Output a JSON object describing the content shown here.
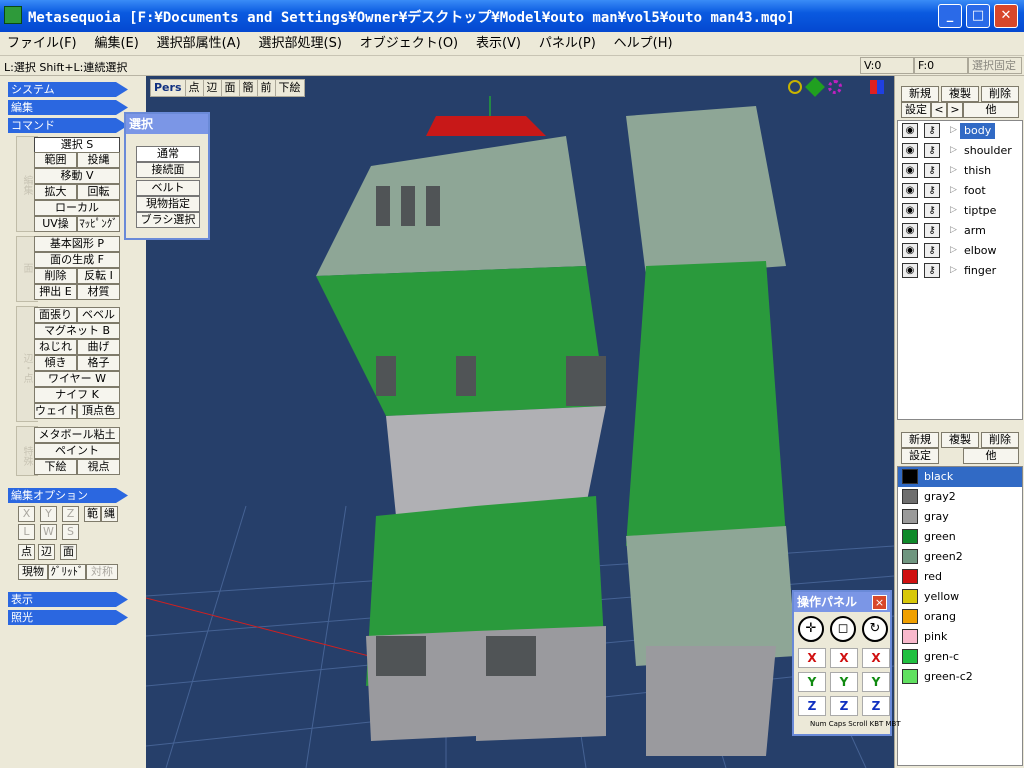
{
  "titlebar": {
    "title": "Metasequoia [F:¥Documents and Settings¥Owner¥デスクトップ¥Model¥outo man¥vol5¥outo man43.mqo]",
    "min": "_",
    "max": "□",
    "close": "✕"
  },
  "menu": [
    "ファイル(F)",
    "編集(E)",
    "選択部属性(A)",
    "選択部処理(S)",
    "オブジェクト(O)",
    "表示(V)",
    "パネル(P)",
    "ヘルプ(H)"
  ],
  "hint": "L:選択  Shift+L:連続選択",
  "status": {
    "v": "V:0",
    "f": "F:0",
    "lock": "選択固定"
  },
  "left": {
    "sections": {
      "system": "システム",
      "edit": "編集",
      "command": "コマンド",
      "editopt": "編集オプション",
      "display": "表示",
      "light": "照光"
    },
    "groups": {
      "g1": "編集",
      "g2": "面",
      "g3": "辺・点",
      "g4": "特殊"
    },
    "cmd": {
      "select": "選択 S",
      "range": "範囲",
      "project": "投縄",
      "move": "移動 V",
      "scale": "拡大",
      "rotate": "回転",
      "local": "ローカル",
      "uv": "UV操",
      "mapping": "ﾏｯﾋﾟﾝｸﾞ",
      "primitive": "基本図形 P",
      "faceGen": "面の生成 F",
      "delete": "削除",
      "flip": "反転 I",
      "extrude": "押出 E",
      "material": "材質",
      "faceStretch": "面張り",
      "bevel": "ベベル",
      "magnet": "マグネット B",
      "twist": "ねじれ",
      "bend": "曲げ",
      "tilt": "傾き",
      "lattice": "格子",
      "wire": "ワイヤー W",
      "knife": "ナイフ K",
      "weight": "ウェイト",
      "vertexColor": "頂点色",
      "metaball": "メタボール粘土",
      "paint": "ペイント",
      "underlay": "下絵",
      "viewpoint": "視点"
    },
    "opts": {
      "x": "X",
      "y": "Y",
      "z": "Z",
      "range": "範",
      "lasso": "縄",
      "l": "L",
      "w": "W",
      "s": "S",
      "point": "点",
      "edge": "辺",
      "face": "面",
      "real": "現物",
      "grid": "ｸﾞﾘｯﾄﾞ",
      "sym": "対称"
    }
  },
  "viewTools": [
    "Pers",
    "点",
    "辺",
    "面",
    "簡",
    "前",
    "下絵"
  ],
  "selectPopup": {
    "title": "選択",
    "items": [
      "通常",
      "接続面",
      "ベルト",
      "現物指定",
      "ブラシ選択"
    ]
  },
  "right": {
    "objBtns": {
      "new": "新規",
      "copy": "複製",
      "del": "削除",
      "set": "設定",
      "prev": "<",
      "next": ">",
      "other": "他"
    },
    "objects": [
      "body",
      "shoulder",
      "thish",
      "foot",
      "tiptpe",
      "arm",
      "elbow",
      "finger"
    ],
    "matBtns": {
      "new": "新規",
      "copy": "複製",
      "del": "削除",
      "set": "設定",
      "other": "他"
    },
    "materials": [
      {
        "name": "black",
        "color": "#000000"
      },
      {
        "name": "gray2",
        "color": "#6e6e6e"
      },
      {
        "name": "gray",
        "color": "#9a9a9a"
      },
      {
        "name": "green",
        "color": "#0f8a2a"
      },
      {
        "name": "green2",
        "color": "#6f9680"
      },
      {
        "name": "red",
        "color": "#d01010"
      },
      {
        "name": "yellow",
        "color": "#d8c80a"
      },
      {
        "name": "orang",
        "color": "#f0a000"
      },
      {
        "name": "pink",
        "color": "#f8b8cc"
      },
      {
        "name": "gren-c",
        "color": "#20c040"
      },
      {
        "name": "green-c2",
        "color": "#60e060"
      }
    ]
  },
  "opPanel": {
    "title": "操作パネル",
    "close": "×",
    "x": "X",
    "y": "Y",
    "z": "Z",
    "kbd": "Num Caps Scroll KBT MBT"
  }
}
